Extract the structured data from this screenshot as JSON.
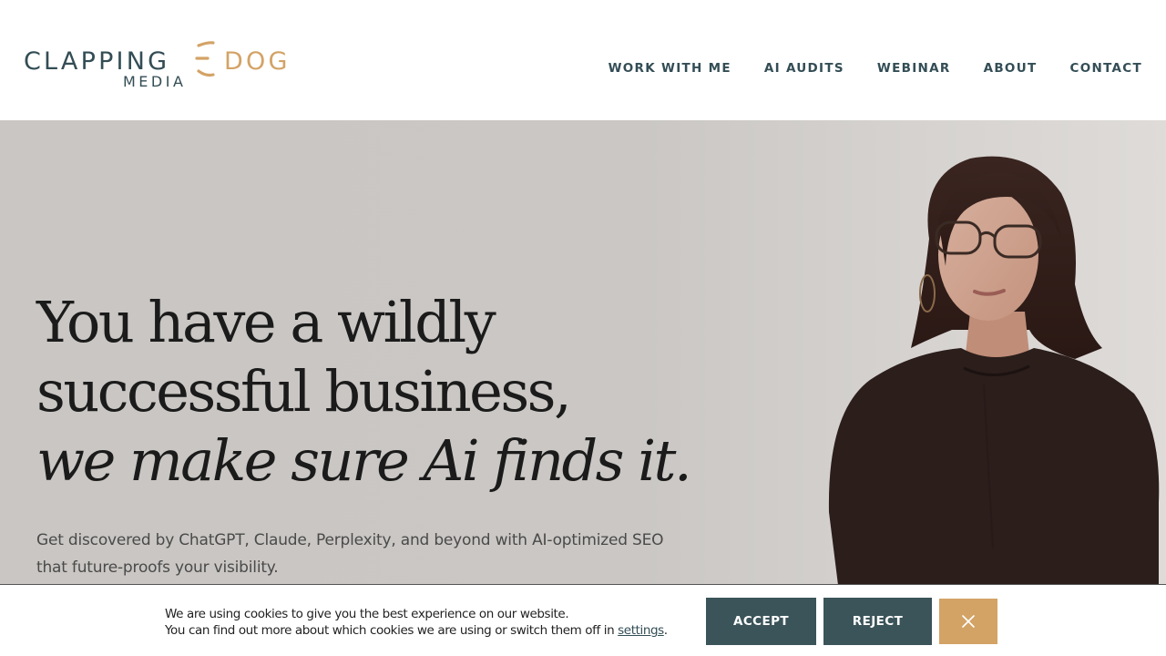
{
  "brand": {
    "name_part1": "CLAPPING",
    "name_part2": "DOG",
    "name_sub": "MEDIA",
    "colors": {
      "primary": "#334d55",
      "accent": "#d3a366"
    }
  },
  "nav": {
    "items": [
      {
        "label": "WORK WITH ME"
      },
      {
        "label": "AI AUDITS"
      },
      {
        "label": "WEBINAR"
      },
      {
        "label": "ABOUT"
      },
      {
        "label": "CONTACT"
      }
    ]
  },
  "hero": {
    "headline_line1": "You have a wildly",
    "headline_line2": "successful business,",
    "headline_line3": "we make sure Ai finds it.",
    "subhead_line1": "Get discovered by ChatGPT, Claude, Perplexity, and beyond with AI-optimized SEO",
    "subhead_line2": "that future-proofs your visibility.",
    "background_color": "#c9c6c3"
  },
  "cookie": {
    "line1": "We are using cookies to give you the best experience on our website.",
    "line2_prefix": "You can find out more about which cookies we are using or switch them off in ",
    "settings_link": "settings",
    "line2_suffix": ".",
    "accept_label": "ACCEPT",
    "reject_label": "REJECT",
    "close_icon": "close-icon"
  }
}
